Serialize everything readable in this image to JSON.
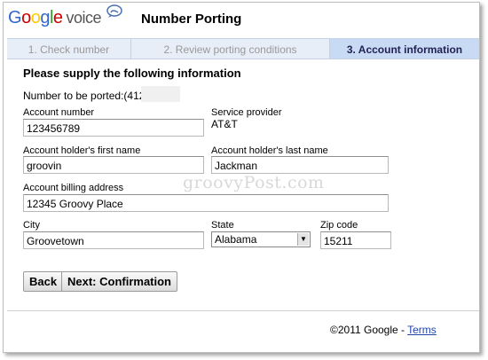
{
  "app": {
    "logo_letters": [
      "G",
      "o",
      "o",
      "g",
      "l",
      "e"
    ],
    "logo_product": "voice",
    "page_title": "Number Porting"
  },
  "steps": [
    {
      "label": "1. Check number",
      "active": false
    },
    {
      "label": "2. Review porting conditions",
      "active": false
    },
    {
      "label": "3. Account information",
      "active": true
    }
  ],
  "form": {
    "heading": "Please supply the following information",
    "number_label": "Number to be ported:",
    "number_prefix": "(412)",
    "account_number": {
      "label": "Account number",
      "value": "123456789"
    },
    "service_provider": {
      "label": "Service provider",
      "value": "AT&T"
    },
    "first_name": {
      "label": "Account holder's first name",
      "value": "groovin"
    },
    "last_name": {
      "label": "Account holder's last name",
      "value": "Jackman"
    },
    "billing_address": {
      "label": "Account billing address",
      "value": "12345 Groovy Place"
    },
    "city": {
      "label": "City",
      "value": "Groovetown"
    },
    "state": {
      "label": "State",
      "value": "Alabama"
    },
    "zip": {
      "label": "Zip code",
      "value": "15211"
    }
  },
  "buttons": {
    "back": "Back",
    "next": "Next: Confirmation"
  },
  "watermark": "groovyPost.com",
  "footer": {
    "copyright": "©2011 Google - ",
    "terms": "Terms"
  },
  "colors": {
    "step_active_bg": "#c9daf4",
    "step_bar_bg": "#e8eef7",
    "link": "#2244aa"
  }
}
